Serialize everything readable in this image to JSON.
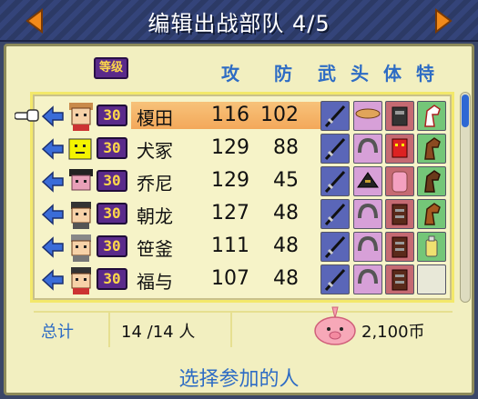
{
  "header": {
    "title": "编辑出战部队 4/5",
    "prev_icon": "arrow-left-icon",
    "next_icon": "arrow-right-icon"
  },
  "columns": {
    "grade": "等级",
    "attack": "攻",
    "defense": "防",
    "weapon": "武",
    "head": "头",
    "body": "体",
    "trait": "特"
  },
  "roster": [
    {
      "level": "30",
      "name": "榎田",
      "attack": "116",
      "defense": "102",
      "selected": true
    },
    {
      "level": "30",
      "name": "犬冢",
      "attack": "129",
      "defense": "88",
      "selected": false
    },
    {
      "level": "30",
      "name": "乔尼",
      "attack": "129",
      "defense": "45",
      "selected": false
    },
    {
      "level": "30",
      "name": "朝龙",
      "attack": "127",
      "defense": "48",
      "selected": false
    },
    {
      "level": "30",
      "name": "笹釜",
      "attack": "111",
      "defense": "48",
      "selected": false
    },
    {
      "level": "30",
      "name": "福与",
      "attack": "107",
      "defense": "48",
      "selected": false
    }
  ],
  "summary": {
    "label": "总计",
    "count": "14 /14 人",
    "money": "2,100币"
  },
  "prompt": "选择参加的人",
  "colors": {
    "accent_blue": "#2e6cc4",
    "panel": "#f2efc0",
    "level_badge": "#5a2a8a",
    "selected_row": "#f3a85a"
  }
}
